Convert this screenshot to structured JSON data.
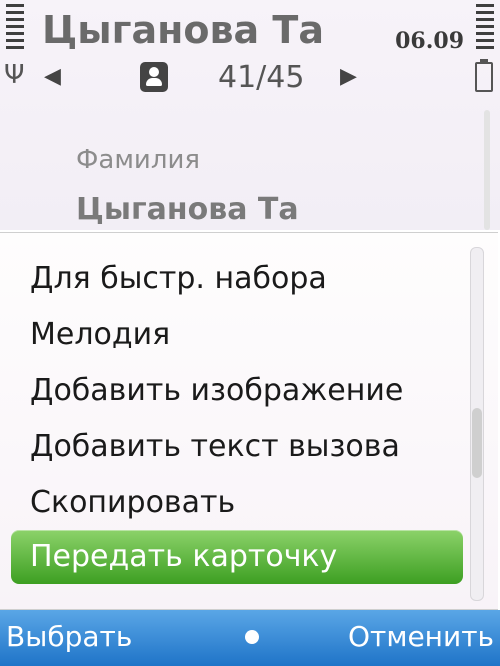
{
  "status": {
    "time": "06.09",
    "signal_icon": "antenna-icon",
    "battery_icon": "battery-icon"
  },
  "header": {
    "title": "Цыганова Та",
    "counter": "41/45",
    "nav_left": "◀",
    "nav_right": "▶",
    "contact_icon": "contact-card-icon"
  },
  "details": {
    "label": "Фамилия",
    "value": "Цыганова Та"
  },
  "menu": {
    "items": [
      "Для быстр. набора",
      "Мелодия",
      "Добавить изображение",
      "Добавить текст вызова",
      "Скопировать",
      "Передать карточку"
    ],
    "selected_index": 5,
    "highlight_color": "#4aab2b"
  },
  "softkeys": {
    "left": "Выбрать",
    "right": "Отменить",
    "bar_color": "#2f85d6"
  }
}
